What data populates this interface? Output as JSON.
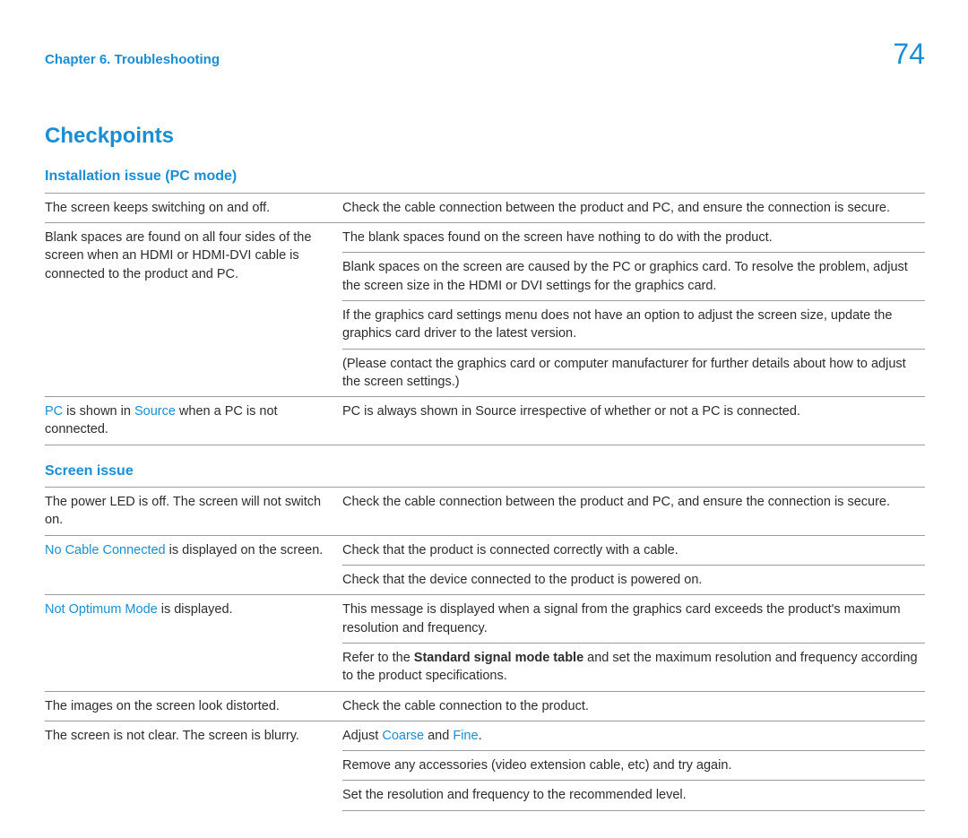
{
  "header": {
    "chapter": "Chapter 6. Troubleshooting",
    "page_number": "74"
  },
  "main_title": "Checkpoints",
  "sections": [
    {
      "title": "Installation issue (PC mode)",
      "rows": [
        {
          "left_plain": "The screen keeps switching on and off.",
          "rights": [
            "Check the cable connection between the product and PC, and ensure the connection is secure."
          ]
        },
        {
          "left_plain": "Blank spaces are found on all four sides of the screen when an HDMI or HDMI-DVI cable is connected to the product and PC.",
          "rights": [
            "The blank spaces found on the screen have nothing to do with the product.",
            "Blank spaces on the screen are caused by the PC or graphics card. To resolve the problem, adjust the screen size in the HDMI or DVI settings for the graphics card.",
            "If the graphics card settings menu does not have an option to adjust the screen size, update the graphics card driver to the latest version.",
            "(Please contact the graphics card or computer manufacturer for further details about how to adjust the screen settings.)"
          ]
        },
        {
          "left_segments": [
            {
              "text": "PC",
              "hl": true
            },
            {
              "text": " is shown in "
            },
            {
              "text": "Source",
              "hl": true
            },
            {
              "text": " when a PC is not connected."
            }
          ],
          "rights": [
            "PC is always shown in Source irrespective of whether or not a PC is connected."
          ]
        }
      ]
    },
    {
      "title": "Screen issue",
      "rows": [
        {
          "left_plain": "The power LED is off. The screen will not switch on.",
          "rights": [
            "Check the cable connection between the product and PC, and ensure the connection is secure."
          ]
        },
        {
          "left_segments": [
            {
              "text": "No Cable Connected",
              "hl": true
            },
            {
              "text": " is displayed on the screen."
            }
          ],
          "rights": [
            "Check that the product is connected correctly with a cable.",
            "Check that the device connected to the product is powered on."
          ]
        },
        {
          "left_segments": [
            {
              "text": "Not Optimum Mode",
              "hl": true
            },
            {
              "text": " is displayed."
            }
          ],
          "rights": [
            "This message is displayed when a signal from the graphics card exceeds the product's maximum resolution and frequency.",
            {
              "segments": [
                {
                  "text": "Refer to the "
                },
                {
                  "text": "Standard signal mode table",
                  "bold": true
                },
                {
                  "text": " and set the maximum resolution and frequency according to the product specifications."
                }
              ]
            }
          ]
        },
        {
          "left_plain": "The images on the screen look distorted.",
          "rights": [
            "Check the cable connection to the product."
          ]
        },
        {
          "left_plain": "The screen is not clear. The screen is blurry.",
          "rights": [
            {
              "segments": [
                {
                  "text": "Adjust "
                },
                {
                  "text": "Coarse",
                  "hl": true
                },
                {
                  "text": " and "
                },
                {
                  "text": "Fine",
                  "hl": true
                },
                {
                  "text": "."
                }
              ]
            },
            "Remove any accessories (video extension cable, etc) and try again.",
            "Set the resolution and frequency to the recommended level."
          ]
        }
      ]
    }
  ]
}
